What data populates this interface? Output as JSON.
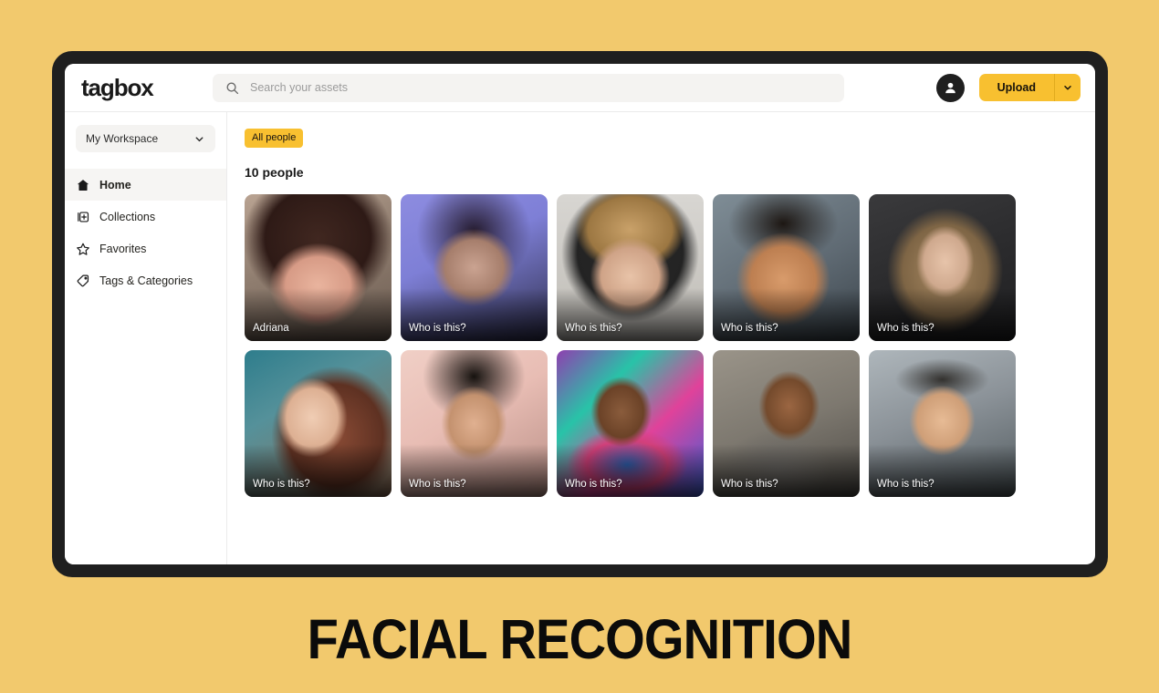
{
  "caption": "FACIAL RECOGNITION",
  "colors": {
    "page_background": "#f2c96d",
    "frame": "#1f1f1f",
    "accent_yellow": "#f8c030",
    "surface": "#ffffff"
  },
  "header": {
    "logo": "tagbox",
    "search": {
      "placeholder": "Search your assets",
      "value": "",
      "icon": "search-icon"
    },
    "avatar_icon": "user-avatar-icon",
    "upload": {
      "label": "Upload",
      "dropdown_icon": "chevron-down-icon"
    }
  },
  "sidebar": {
    "workspace": {
      "label": "My Workspace",
      "icon": "chevron-down-icon"
    },
    "items": [
      {
        "label": "Home",
        "icon": "home-icon",
        "active": true
      },
      {
        "label": "Collections",
        "icon": "collections-icon",
        "active": false
      },
      {
        "label": "Favorites",
        "icon": "star-icon",
        "active": false
      },
      {
        "label": "Tags & Categories",
        "icon": "tag-icon",
        "active": false
      }
    ]
  },
  "main": {
    "filter_chip": "All people",
    "count_heading": "10 people",
    "people": [
      {
        "name": "Adriana",
        "identified": true
      },
      {
        "name": "Who is this?",
        "identified": false
      },
      {
        "name": "Who is this?",
        "identified": false
      },
      {
        "name": "Who is this?",
        "identified": false
      },
      {
        "name": "Who is this?",
        "identified": false
      },
      {
        "name": "Who is this?",
        "identified": false
      },
      {
        "name": "Who is this?",
        "identified": false
      },
      {
        "name": "Who is this?",
        "identified": false
      },
      {
        "name": "Who is this?",
        "identified": false
      },
      {
        "name": "Who is this?",
        "identified": false
      }
    ]
  }
}
